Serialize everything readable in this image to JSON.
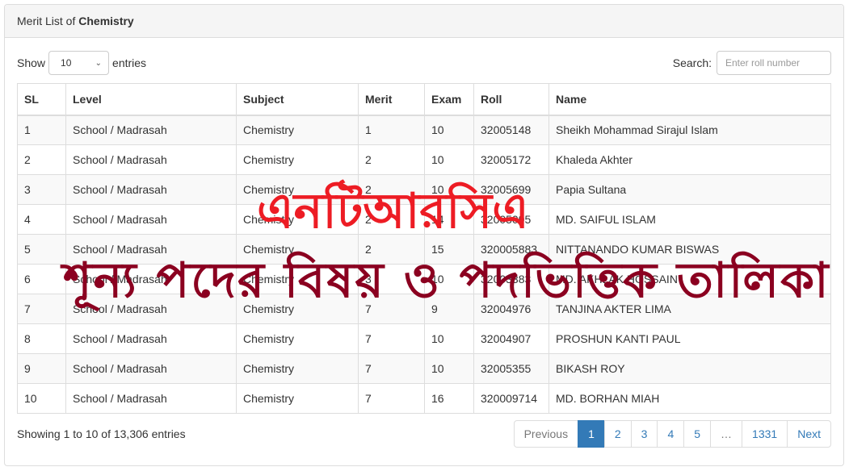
{
  "panel": {
    "title_prefix": "Merit List of ",
    "title_subject": "Chemistry"
  },
  "length": {
    "show_label": "Show",
    "selected": "10",
    "entries_label": "entries"
  },
  "search": {
    "label": "Search:",
    "placeholder": "Enter roll number",
    "value": ""
  },
  "table": {
    "columns": [
      "SL",
      "Level",
      "Subject",
      "Merit",
      "Exam",
      "Roll",
      "Name"
    ],
    "rows": [
      [
        "1",
        "School / Madrasah",
        "Chemistry",
        "1",
        "10",
        "32005148",
        "Sheikh Mohammad Sirajul Islam"
      ],
      [
        "2",
        "School / Madrasah",
        "Chemistry",
        "2",
        "10",
        "32005172",
        "Khaleda Akhter"
      ],
      [
        "3",
        "School / Madrasah",
        "Chemistry",
        "2",
        "10",
        "32005699",
        "Papia Sultana"
      ],
      [
        "4",
        "School / Madrasah",
        "Chemistry",
        "2",
        "14",
        "32005095",
        "MD. SAIFUL ISLAM"
      ],
      [
        "5",
        "School / Madrasah",
        "Chemistry",
        "2",
        "15",
        "320005883",
        "NITTANANDO KUMAR BISWAS"
      ],
      [
        "6",
        "School / Madrasah",
        "Chemistry",
        "3",
        "10",
        "32003383",
        "MD. AKHLAK HOSSAIN"
      ],
      [
        "7",
        "School / Madrasah",
        "Chemistry",
        "7",
        "9",
        "32004976",
        "TANJINA AKTER LIMA"
      ],
      [
        "8",
        "School / Madrasah",
        "Chemistry",
        "7",
        "10",
        "32004907",
        "PROSHUN KANTI PAUL"
      ],
      [
        "9",
        "School / Madrasah",
        "Chemistry",
        "7",
        "10",
        "32005355",
        "BIKASH ROY"
      ],
      [
        "10",
        "School / Madrasah",
        "Chemistry",
        "7",
        "16",
        "320009714",
        "MD. BORHAN MIAH"
      ]
    ]
  },
  "info": "Showing 1 to 10 of 13,306 entries",
  "pagination": {
    "previous": "Previous",
    "pages": [
      "1",
      "2",
      "3",
      "4",
      "5"
    ],
    "ellipsis": "…",
    "last": "1331",
    "next": "Next",
    "active": "1"
  },
  "overlay": {
    "line1": "এনটিআরসিএ",
    "line2": "শূন্য পদের বিষয় ও পদভিত্তিক তালিকা",
    "line1_color": "#ed1c24",
    "line2_color": "#8b0020"
  },
  "colors": {
    "primary": "#337ab7"
  }
}
